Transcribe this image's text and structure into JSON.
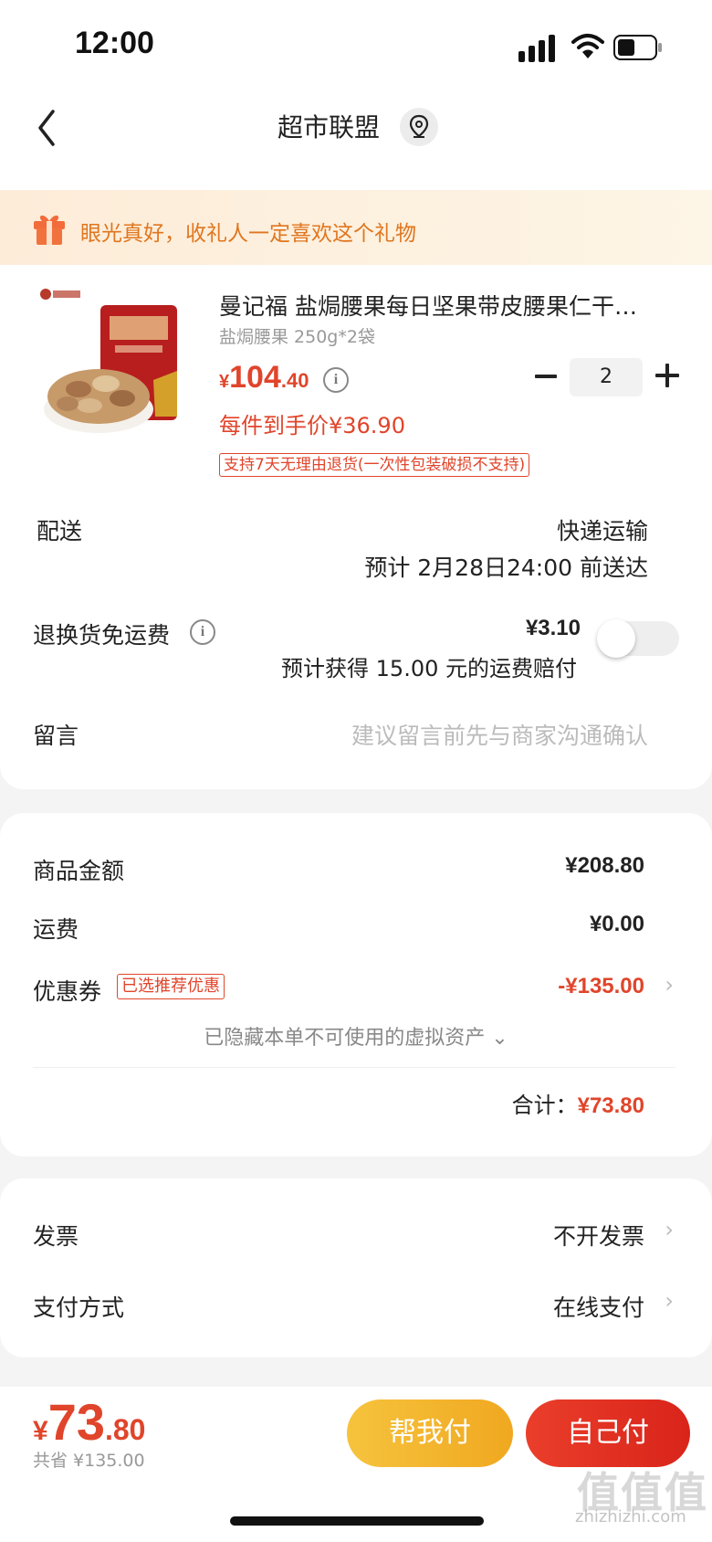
{
  "status_bar": {
    "time": "12:00"
  },
  "nav": {
    "title": "超市联盟"
  },
  "gift_banner": {
    "text": "眼光真好，收礼人一定喜欢这个礼物"
  },
  "product": {
    "title": "曼记福 盐焗腰果每日坚果带皮腰果仁干…",
    "spec": "盐焗腰果 250g*2袋",
    "price_currency": "¥",
    "price_int": "104",
    "price_dec": ".40",
    "quantity": "2",
    "unit_price": "每件到手价¥36.90",
    "return_tag": "支持7天无理由退货(一次性包装破损不支持)"
  },
  "delivery": {
    "label": "配送",
    "method": "快递运输",
    "eta": "预计 2月28日24:00 前送达"
  },
  "return_shipping": {
    "label": "退换货免运费",
    "price": "¥3.10",
    "desc": "预计获得 15.00 元的运费赔付",
    "enabled": false
  },
  "message": {
    "label": "留言",
    "placeholder": "建议留言前先与商家沟通确认"
  },
  "summary": {
    "goods_label": "商品金额",
    "goods_value": "¥208.80",
    "shipping_label": "运费",
    "shipping_value": "¥0.00",
    "coupon_label": "优惠券",
    "coupon_tag": "已选推荐优惠",
    "coupon_value": "-¥135.00",
    "hidden_assets": "已隐藏本单不可使用的虚拟资产",
    "total_label": "合计：",
    "total_value": "¥73.80"
  },
  "invoice": {
    "label": "发票",
    "value": "不开发票",
    "pay_label": "支付方式",
    "pay_value": "在线支付"
  },
  "bottom": {
    "currency": "¥",
    "price_int": "73",
    "price_dec": ".80",
    "saved": "共省 ¥135.00",
    "help_pay": "帮我付",
    "self_pay": "自己付"
  },
  "watermark": {
    "main": "值值值",
    "sub": "zhizhizhi.com"
  },
  "colors": {
    "accent": "#e0452b",
    "gold": "#f0a820",
    "banner": "#fdecd8"
  }
}
